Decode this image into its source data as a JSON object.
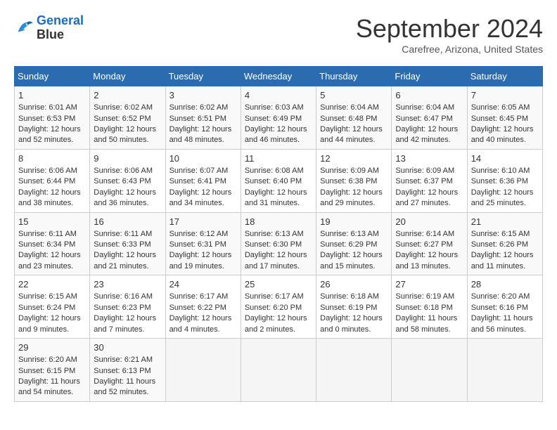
{
  "header": {
    "logo_line1": "General",
    "logo_line2": "Blue",
    "month": "September 2024",
    "location": "Carefree, Arizona, United States"
  },
  "weekdays": [
    "Sunday",
    "Monday",
    "Tuesday",
    "Wednesday",
    "Thursday",
    "Friday",
    "Saturday"
  ],
  "weeks": [
    [
      {
        "day": "1",
        "lines": [
          "Sunrise: 6:01 AM",
          "Sunset: 6:53 PM",
          "Daylight: 12 hours",
          "and 52 minutes."
        ]
      },
      {
        "day": "2",
        "lines": [
          "Sunrise: 6:02 AM",
          "Sunset: 6:52 PM",
          "Daylight: 12 hours",
          "and 50 minutes."
        ]
      },
      {
        "day": "3",
        "lines": [
          "Sunrise: 6:02 AM",
          "Sunset: 6:51 PM",
          "Daylight: 12 hours",
          "and 48 minutes."
        ]
      },
      {
        "day": "4",
        "lines": [
          "Sunrise: 6:03 AM",
          "Sunset: 6:49 PM",
          "Daylight: 12 hours",
          "and 46 minutes."
        ]
      },
      {
        "day": "5",
        "lines": [
          "Sunrise: 6:04 AM",
          "Sunset: 6:48 PM",
          "Daylight: 12 hours",
          "and 44 minutes."
        ]
      },
      {
        "day": "6",
        "lines": [
          "Sunrise: 6:04 AM",
          "Sunset: 6:47 PM",
          "Daylight: 12 hours",
          "and 42 minutes."
        ]
      },
      {
        "day": "7",
        "lines": [
          "Sunrise: 6:05 AM",
          "Sunset: 6:45 PM",
          "Daylight: 12 hours",
          "and 40 minutes."
        ]
      }
    ],
    [
      {
        "day": "8",
        "lines": [
          "Sunrise: 6:06 AM",
          "Sunset: 6:44 PM",
          "Daylight: 12 hours",
          "and 38 minutes."
        ]
      },
      {
        "day": "9",
        "lines": [
          "Sunrise: 6:06 AM",
          "Sunset: 6:43 PM",
          "Daylight: 12 hours",
          "and 36 minutes."
        ]
      },
      {
        "day": "10",
        "lines": [
          "Sunrise: 6:07 AM",
          "Sunset: 6:41 PM",
          "Daylight: 12 hours",
          "and 34 minutes."
        ]
      },
      {
        "day": "11",
        "lines": [
          "Sunrise: 6:08 AM",
          "Sunset: 6:40 PM",
          "Daylight: 12 hours",
          "and 31 minutes."
        ]
      },
      {
        "day": "12",
        "lines": [
          "Sunrise: 6:09 AM",
          "Sunset: 6:38 PM",
          "Daylight: 12 hours",
          "and 29 minutes."
        ]
      },
      {
        "day": "13",
        "lines": [
          "Sunrise: 6:09 AM",
          "Sunset: 6:37 PM",
          "Daylight: 12 hours",
          "and 27 minutes."
        ]
      },
      {
        "day": "14",
        "lines": [
          "Sunrise: 6:10 AM",
          "Sunset: 6:36 PM",
          "Daylight: 12 hours",
          "and 25 minutes."
        ]
      }
    ],
    [
      {
        "day": "15",
        "lines": [
          "Sunrise: 6:11 AM",
          "Sunset: 6:34 PM",
          "Daylight: 12 hours",
          "and 23 minutes."
        ]
      },
      {
        "day": "16",
        "lines": [
          "Sunrise: 6:11 AM",
          "Sunset: 6:33 PM",
          "Daylight: 12 hours",
          "and 21 minutes."
        ]
      },
      {
        "day": "17",
        "lines": [
          "Sunrise: 6:12 AM",
          "Sunset: 6:31 PM",
          "Daylight: 12 hours",
          "and 19 minutes."
        ]
      },
      {
        "day": "18",
        "lines": [
          "Sunrise: 6:13 AM",
          "Sunset: 6:30 PM",
          "Daylight: 12 hours",
          "and 17 minutes."
        ]
      },
      {
        "day": "19",
        "lines": [
          "Sunrise: 6:13 AM",
          "Sunset: 6:29 PM",
          "Daylight: 12 hours",
          "and 15 minutes."
        ]
      },
      {
        "day": "20",
        "lines": [
          "Sunrise: 6:14 AM",
          "Sunset: 6:27 PM",
          "Daylight: 12 hours",
          "and 13 minutes."
        ]
      },
      {
        "day": "21",
        "lines": [
          "Sunrise: 6:15 AM",
          "Sunset: 6:26 PM",
          "Daylight: 12 hours",
          "and 11 minutes."
        ]
      }
    ],
    [
      {
        "day": "22",
        "lines": [
          "Sunrise: 6:15 AM",
          "Sunset: 6:24 PM",
          "Daylight: 12 hours",
          "and 9 minutes."
        ]
      },
      {
        "day": "23",
        "lines": [
          "Sunrise: 6:16 AM",
          "Sunset: 6:23 PM",
          "Daylight: 12 hours",
          "and 7 minutes."
        ]
      },
      {
        "day": "24",
        "lines": [
          "Sunrise: 6:17 AM",
          "Sunset: 6:22 PM",
          "Daylight: 12 hours",
          "and 4 minutes."
        ]
      },
      {
        "day": "25",
        "lines": [
          "Sunrise: 6:17 AM",
          "Sunset: 6:20 PM",
          "Daylight: 12 hours",
          "and 2 minutes."
        ]
      },
      {
        "day": "26",
        "lines": [
          "Sunrise: 6:18 AM",
          "Sunset: 6:19 PM",
          "Daylight: 12 hours",
          "and 0 minutes."
        ]
      },
      {
        "day": "27",
        "lines": [
          "Sunrise: 6:19 AM",
          "Sunset: 6:18 PM",
          "Daylight: 11 hours",
          "and 58 minutes."
        ]
      },
      {
        "day": "28",
        "lines": [
          "Sunrise: 6:20 AM",
          "Sunset: 6:16 PM",
          "Daylight: 11 hours",
          "and 56 minutes."
        ]
      }
    ],
    [
      {
        "day": "29",
        "lines": [
          "Sunrise: 6:20 AM",
          "Sunset: 6:15 PM",
          "Daylight: 11 hours",
          "and 54 minutes."
        ]
      },
      {
        "day": "30",
        "lines": [
          "Sunrise: 6:21 AM",
          "Sunset: 6:13 PM",
          "Daylight: 11 hours",
          "and 52 minutes."
        ]
      },
      null,
      null,
      null,
      null,
      null
    ]
  ]
}
